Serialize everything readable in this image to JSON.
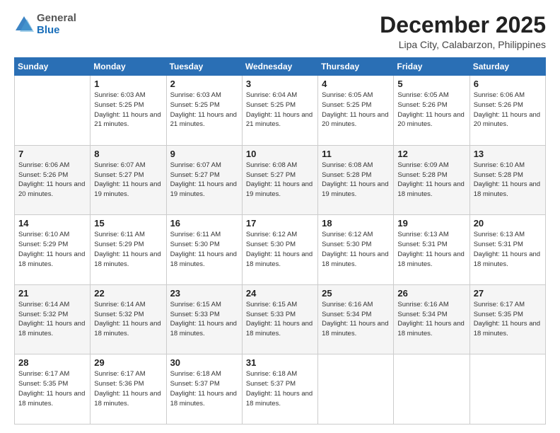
{
  "header": {
    "logo": {
      "general": "General",
      "blue": "Blue"
    },
    "title": "December 2025",
    "location": "Lipa City, Calabarzon, Philippines"
  },
  "calendar": {
    "weekdays": [
      "Sunday",
      "Monday",
      "Tuesday",
      "Wednesday",
      "Thursday",
      "Friday",
      "Saturday"
    ],
    "weeks": [
      [
        {
          "day": "",
          "info": ""
        },
        {
          "day": "1",
          "info": "Sunrise: 6:03 AM\nSunset: 5:25 PM\nDaylight: 11 hours\nand 21 minutes."
        },
        {
          "day": "2",
          "info": "Sunrise: 6:03 AM\nSunset: 5:25 PM\nDaylight: 11 hours\nand 21 minutes."
        },
        {
          "day": "3",
          "info": "Sunrise: 6:04 AM\nSunset: 5:25 PM\nDaylight: 11 hours\nand 21 minutes."
        },
        {
          "day": "4",
          "info": "Sunrise: 6:05 AM\nSunset: 5:25 PM\nDaylight: 11 hours\nand 20 minutes."
        },
        {
          "day": "5",
          "info": "Sunrise: 6:05 AM\nSunset: 5:26 PM\nDaylight: 11 hours\nand 20 minutes."
        },
        {
          "day": "6",
          "info": "Sunrise: 6:06 AM\nSunset: 5:26 PM\nDaylight: 11 hours\nand 20 minutes."
        }
      ],
      [
        {
          "day": "7",
          "info": "Sunrise: 6:06 AM\nSunset: 5:26 PM\nDaylight: 11 hours\nand 20 minutes."
        },
        {
          "day": "8",
          "info": "Sunrise: 6:07 AM\nSunset: 5:27 PM\nDaylight: 11 hours\nand 19 minutes."
        },
        {
          "day": "9",
          "info": "Sunrise: 6:07 AM\nSunset: 5:27 PM\nDaylight: 11 hours\nand 19 minutes."
        },
        {
          "day": "10",
          "info": "Sunrise: 6:08 AM\nSunset: 5:27 PM\nDaylight: 11 hours\nand 19 minutes."
        },
        {
          "day": "11",
          "info": "Sunrise: 6:08 AM\nSunset: 5:28 PM\nDaylight: 11 hours\nand 19 minutes."
        },
        {
          "day": "12",
          "info": "Sunrise: 6:09 AM\nSunset: 5:28 PM\nDaylight: 11 hours\nand 18 minutes."
        },
        {
          "day": "13",
          "info": "Sunrise: 6:10 AM\nSunset: 5:28 PM\nDaylight: 11 hours\nand 18 minutes."
        }
      ],
      [
        {
          "day": "14",
          "info": "Sunrise: 6:10 AM\nSunset: 5:29 PM\nDaylight: 11 hours\nand 18 minutes."
        },
        {
          "day": "15",
          "info": "Sunrise: 6:11 AM\nSunset: 5:29 PM\nDaylight: 11 hours\nand 18 minutes."
        },
        {
          "day": "16",
          "info": "Sunrise: 6:11 AM\nSunset: 5:30 PM\nDaylight: 11 hours\nand 18 minutes."
        },
        {
          "day": "17",
          "info": "Sunrise: 6:12 AM\nSunset: 5:30 PM\nDaylight: 11 hours\nand 18 minutes."
        },
        {
          "day": "18",
          "info": "Sunrise: 6:12 AM\nSunset: 5:30 PM\nDaylight: 11 hours\nand 18 minutes."
        },
        {
          "day": "19",
          "info": "Sunrise: 6:13 AM\nSunset: 5:31 PM\nDaylight: 11 hours\nand 18 minutes."
        },
        {
          "day": "20",
          "info": "Sunrise: 6:13 AM\nSunset: 5:31 PM\nDaylight: 11 hours\nand 18 minutes."
        }
      ],
      [
        {
          "day": "21",
          "info": "Sunrise: 6:14 AM\nSunset: 5:32 PM\nDaylight: 11 hours\nand 18 minutes."
        },
        {
          "day": "22",
          "info": "Sunrise: 6:14 AM\nSunset: 5:32 PM\nDaylight: 11 hours\nand 18 minutes."
        },
        {
          "day": "23",
          "info": "Sunrise: 6:15 AM\nSunset: 5:33 PM\nDaylight: 11 hours\nand 18 minutes."
        },
        {
          "day": "24",
          "info": "Sunrise: 6:15 AM\nSunset: 5:33 PM\nDaylight: 11 hours\nand 18 minutes."
        },
        {
          "day": "25",
          "info": "Sunrise: 6:16 AM\nSunset: 5:34 PM\nDaylight: 11 hours\nand 18 minutes."
        },
        {
          "day": "26",
          "info": "Sunrise: 6:16 AM\nSunset: 5:34 PM\nDaylight: 11 hours\nand 18 minutes."
        },
        {
          "day": "27",
          "info": "Sunrise: 6:17 AM\nSunset: 5:35 PM\nDaylight: 11 hours\nand 18 minutes."
        }
      ],
      [
        {
          "day": "28",
          "info": "Sunrise: 6:17 AM\nSunset: 5:35 PM\nDaylight: 11 hours\nand 18 minutes."
        },
        {
          "day": "29",
          "info": "Sunrise: 6:17 AM\nSunset: 5:36 PM\nDaylight: 11 hours\nand 18 minutes."
        },
        {
          "day": "30",
          "info": "Sunrise: 6:18 AM\nSunset: 5:37 PM\nDaylight: 11 hours\nand 18 minutes."
        },
        {
          "day": "31",
          "info": "Sunrise: 6:18 AM\nSunset: 5:37 PM\nDaylight: 11 hours\nand 18 minutes."
        },
        {
          "day": "",
          "info": ""
        },
        {
          "day": "",
          "info": ""
        },
        {
          "day": "",
          "info": ""
        }
      ]
    ]
  }
}
